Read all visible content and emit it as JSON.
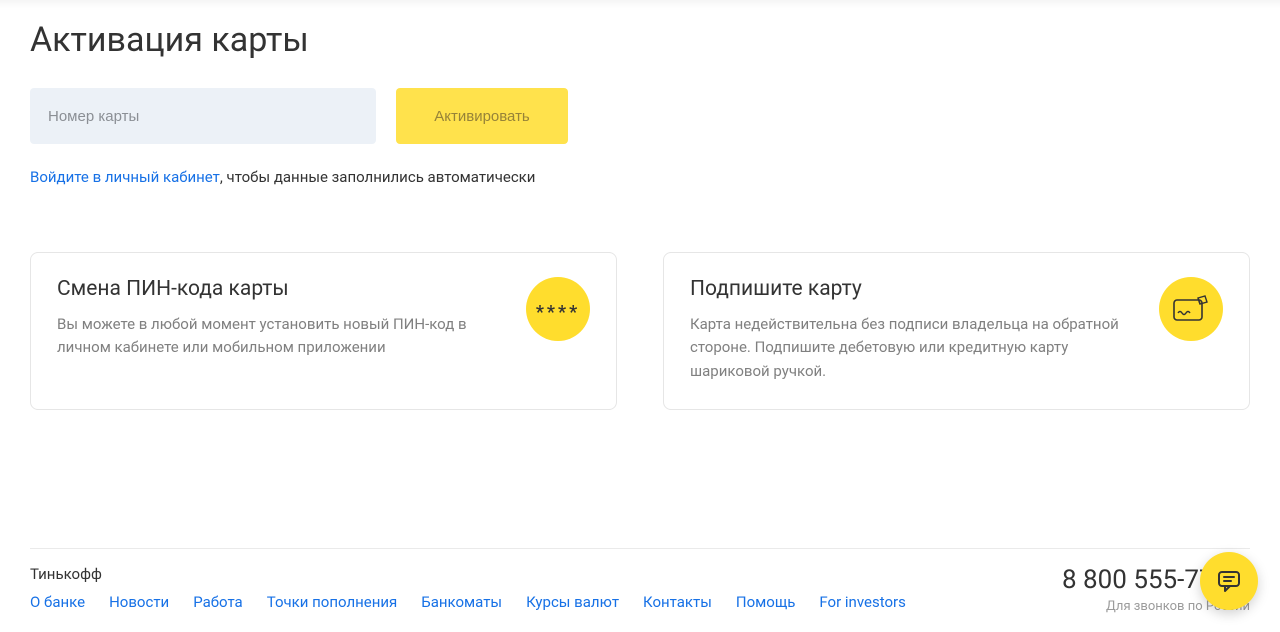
{
  "page": {
    "title": "Активация карты"
  },
  "form": {
    "card_placeholder": "Номер карты",
    "activate_label": "Активировать"
  },
  "login_hint": {
    "link_text": "Войдите в личный кабинет",
    "rest_text": ", чтобы данные заполнились автоматически"
  },
  "cards": {
    "pin": {
      "title": "Смена ПИН-кода карты",
      "desc": "Вы можете в любой момент установить новый ПИН-код в личном кабинете или мобильном приложении",
      "icon_text": "****"
    },
    "sign": {
      "title": "Подпишите карту",
      "desc": "Карта недействительна без подписи владельца на обратной стороне. Подпишите дебетовую или кредитную карту шариковой ручкой."
    }
  },
  "footer": {
    "brand": "Тинькофф",
    "phone": "8 800 555-777-8",
    "phone_sub": "Для звонков по России",
    "nav": [
      "О банке",
      "Новости",
      "Работа",
      "Точки пополнения",
      "Банкоматы",
      "Курсы валют",
      "Контакты",
      "Помощь",
      "For investors"
    ]
  }
}
